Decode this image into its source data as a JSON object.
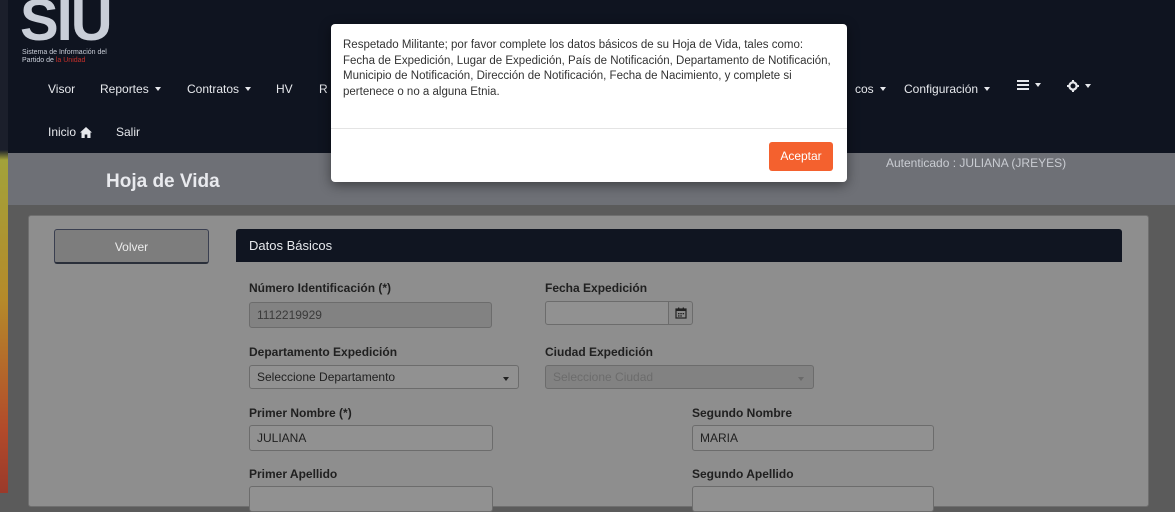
{
  "brand": {
    "logo": "SIU",
    "subtitle_line1": "Sistema de Información del",
    "subtitle_line2a": "Partido de ",
    "subtitle_line2b": "la Unidad"
  },
  "nav": {
    "row1": [
      "Visor",
      "Reportes",
      "Contratos",
      "HV",
      "R",
      "cos",
      "Configuración"
    ],
    "visor": "Visor",
    "reportes": "Reportes",
    "contratos": "Contratos",
    "hv": "HV",
    "r_partial": "R",
    "cos_partial": "cos",
    "configuracion": "Configuración",
    "inicio": "Inicio",
    "salir": "Salir"
  },
  "header": {
    "title": "Hoja de Vida",
    "authenticated": "Autenticado : JULIANA (JREYES)"
  },
  "actions": {
    "volver": "Volver"
  },
  "panel": {
    "title": "Datos Básicos",
    "numero_identificacion": {
      "label": "Número Identificación (*)",
      "value": "1112219929"
    },
    "fecha_expedicion": {
      "label": "Fecha Expedición",
      "value": ""
    },
    "departamento_expedicion": {
      "label": "Departamento Expedición",
      "value": "Seleccione Departamento"
    },
    "ciudad_expedicion": {
      "label": "Ciudad Expedición",
      "value": "Seleccione Ciudad"
    },
    "primer_nombre": {
      "label": "Primer Nombre (*)",
      "value": "JULIANA"
    },
    "segundo_nombre": {
      "label": "Segundo Nombre",
      "value": "MARIA"
    },
    "primer_apellido": {
      "label": "Primer Apellido",
      "value": ""
    },
    "segundo_apellido": {
      "label": "Segundo Apellido",
      "value": ""
    }
  },
  "modal": {
    "message": "Respetado Militante; por favor complete los datos básicos de su Hoja de Vida, tales como: Fecha de Expedición, Lugar de Expedición, País de Notificación, Departamento de Notificación, Municipio de Notificación, Dirección de Notificación, Fecha de Nacimiento, y complete si pertenece o no a alguna Etnia.",
    "accept": "Aceptar"
  },
  "colors": {
    "accent": "#f4612e",
    "navbar": "#0f1420",
    "panel_header": "#101521"
  }
}
